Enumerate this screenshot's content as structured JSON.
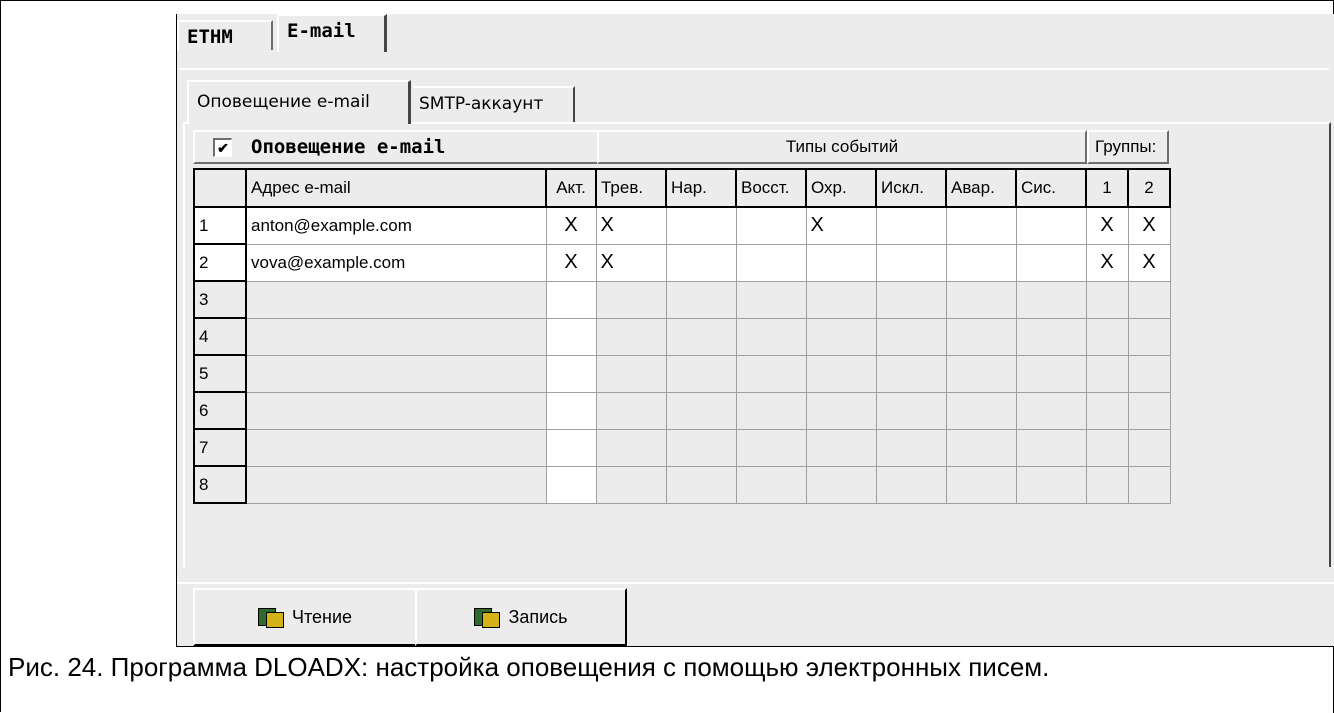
{
  "tabs_main": [
    "ETHM",
    "E-mail"
  ],
  "tabs_sub": [
    "Оповещение e-mail",
    "SMTP-аккаунт"
  ],
  "notify": {
    "checked": true,
    "label": "Оповещение e-mail"
  },
  "band": {
    "types": "Типы событий",
    "groups": "Группы:"
  },
  "columns": [
    "Адрес e-mail",
    "Акт.",
    "Трев.",
    "Нар.",
    "Восст.",
    "Охр.",
    "Искл.",
    "Авар.",
    "Сис.",
    "1",
    "2"
  ],
  "rows": [
    {
      "n": "1",
      "email": "anton@example.com",
      "marks": [
        "X",
        "X",
        "",
        "",
        "X",
        "",
        "",
        "",
        "X",
        "X"
      ]
    },
    {
      "n": "2",
      "email": "vova@example.com",
      "marks": [
        "X",
        "X",
        "",
        "",
        "",
        "",
        "",
        "",
        "X",
        "X"
      ]
    },
    {
      "n": "3",
      "email": "",
      "marks": [
        "",
        "",
        "",
        "",
        "",
        "",
        "",
        "",
        "",
        ""
      ]
    },
    {
      "n": "4",
      "email": "",
      "marks": [
        "",
        "",
        "",
        "",
        "",
        "",
        "",
        "",
        "",
        ""
      ]
    },
    {
      "n": "5",
      "email": "",
      "marks": [
        "",
        "",
        "",
        "",
        "",
        "",
        "",
        "",
        "",
        ""
      ]
    },
    {
      "n": "6",
      "email": "",
      "marks": [
        "",
        "",
        "",
        "",
        "",
        "",
        "",
        "",
        "",
        ""
      ]
    },
    {
      "n": "7",
      "email": "",
      "marks": [
        "",
        "",
        "",
        "",
        "",
        "",
        "",
        "",
        "",
        ""
      ]
    },
    {
      "n": "8",
      "email": "",
      "marks": [
        "",
        "",
        "",
        "",
        "",
        "",
        "",
        "",
        "",
        ""
      ]
    }
  ],
  "buttons": {
    "read": "Чтение",
    "write": "Запись"
  },
  "caption": "Рис. 24. Программа DLOADX: настройка оповещения с помощью электронных писем."
}
